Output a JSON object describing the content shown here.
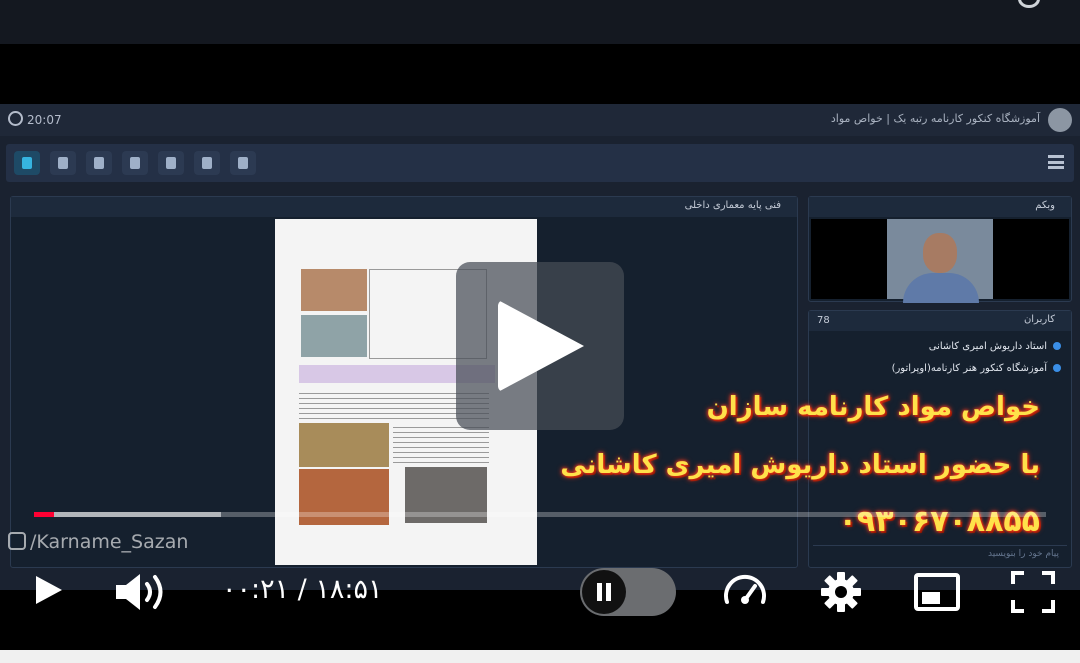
{
  "embedded": {
    "clock": "20:07",
    "room_title": "آموزشگاه کنکور کارنامه رتبه یک | خواص مواد",
    "doc_panel_title": "فنی پایه معماری داخلی",
    "webcam_panel_title": "وبکم",
    "users_panel_title": "کاربران",
    "users_count": "78",
    "users": [
      "استاد داریوش امیری کاشانی",
      "آموزشگاه کنکور هنر کارنامه(اوپراتور)"
    ],
    "chat_placeholder": "پیام خود را بنویسید"
  },
  "overlay": {
    "promo_line_1": "خواص مواد کارنامه سازان",
    "promo_line_2": "با حضور استاد داریوش امیری کاشانی",
    "promo_phone": "۰۹۳۰۶۷۰۸۸۵۵",
    "watermark": "/Karname_Sazan"
  },
  "player": {
    "time_display": "۰۰:۲۱ / ۱۸:۵۱",
    "progress_played_fraction": 0.02,
    "progress_buffered_fraction": 0.185,
    "autoplay_on": true
  },
  "icons": {
    "play": "play-icon",
    "volume": "volume-icon",
    "pause": "pause-icon",
    "speed": "speedometer-icon",
    "settings": "gear-icon",
    "miniplayer": "miniplayer-icon",
    "fullscreen": "fullscreen-icon"
  }
}
